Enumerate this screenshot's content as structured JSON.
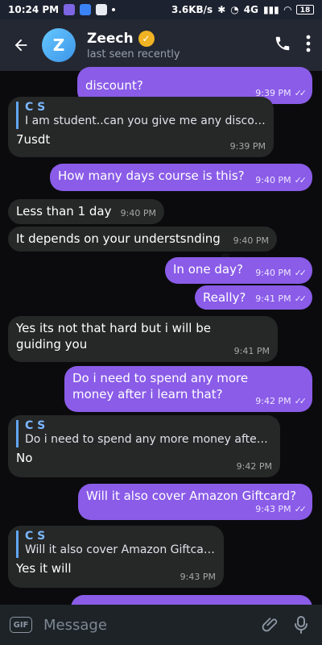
{
  "status_bar": {
    "time": "10:24 PM",
    "speed": "3.6KB/s",
    "signal": "4G",
    "battery": "18",
    "icons": [
      "purple-app-icon",
      "blue-app-icon",
      "bluetooth-icon",
      "wifi-icon",
      "battery-icon"
    ]
  },
  "header": {
    "avatar_initial": "Z",
    "name": "Zeech",
    "status": "last seen recently",
    "colors": {
      "app_bar": "#242833",
      "avatar": "#4aa7ef",
      "verified": "#f0b323"
    }
  },
  "messages": [
    {
      "id": "m1",
      "side": "outgoing",
      "text": "discount?",
      "time": "9:39 PM",
      "ticks": "✓✓"
    },
    {
      "id": "m2",
      "side": "incoming",
      "reply_name": "C S",
      "reply_text": "I am student..can you give me any discount?",
      "text": "7usdt",
      "time": "9:39 PM"
    },
    {
      "id": "m3",
      "side": "outgoing",
      "text": "How many days course is this?",
      "time": "9:40 PM",
      "ticks": "✓✓"
    },
    {
      "id": "m4",
      "side": "incoming",
      "text": "Less than 1 day",
      "time": "9:40 PM"
    },
    {
      "id": "m5",
      "side": "incoming",
      "text": "It depends on your understsnding",
      "time": "9:40 PM"
    },
    {
      "id": "m6",
      "side": "outgoing",
      "text": "In one day?",
      "time": "9:40 PM",
      "ticks": "✓✓"
    },
    {
      "id": "m7",
      "side": "outgoing",
      "text": "Really?",
      "time": "9:41 PM",
      "ticks": "✓✓"
    },
    {
      "id": "m8",
      "side": "incoming",
      "text": "Yes its not that hard but i will be guiding you",
      "time": "9:41 PM"
    },
    {
      "id": "m9",
      "side": "outgoing",
      "text": "Do i need to spend any more money after i learn that?",
      "time": "9:42 PM",
      "ticks": "✓✓"
    },
    {
      "id": "m10",
      "side": "incoming",
      "reply_name": "C S",
      "reply_text": "Do i need to spend any more money after i...",
      "text": "No",
      "time": "9:42 PM"
    },
    {
      "id": "m11",
      "side": "outgoing",
      "text": "Will it also cover Amazon Giftcard?",
      "time": "9:43 PM",
      "ticks": "✓✓"
    },
    {
      "id": "m12",
      "side": "incoming",
      "reply_name": "C S",
      "reply_text": "Will it also cover Amazon Giftcard?",
      "text": "Yes it will",
      "time": "9:43 PM"
    }
  ],
  "composer": {
    "placeholder": "Message",
    "gif_label": "GIF"
  }
}
